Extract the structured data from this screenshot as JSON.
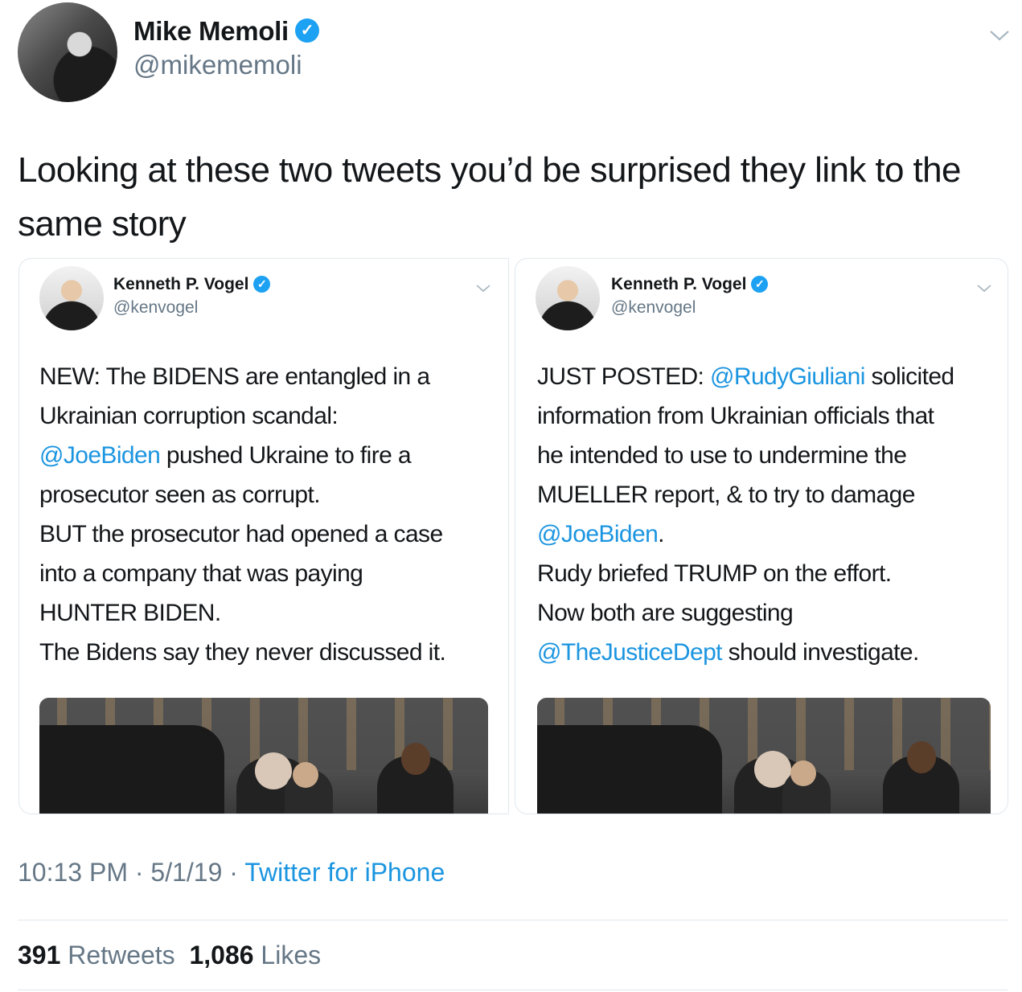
{
  "author": {
    "name": "Mike Memoli",
    "handle": "@mikememoli",
    "verified_icon": "✓"
  },
  "tweet_text": "Looking at these two tweets you’d be surprised they link to the same story",
  "quoted": [
    {
      "name": "Kenneth P. Vogel",
      "handle": "@kenvogel",
      "verified_icon": "✓",
      "lines": [
        [
          {
            "t": "NEW: The BIDENS are entangled in a",
            "m": false
          }
        ],
        [
          {
            "t": "Ukrainian corruption scandal:",
            "m": false
          }
        ],
        [
          {
            "t": "@JoeBiden",
            "m": true
          },
          {
            "t": " pushed Ukraine to fire a",
            "m": false
          }
        ],
        [
          {
            "t": "prosecutor seen as corrupt.",
            "m": false
          }
        ],
        [
          {
            "t": "BUT the prosecutor had opened a case",
            "m": false
          }
        ],
        [
          {
            "t": "into a company that was paying",
            "m": false
          }
        ],
        [
          {
            "t": "HUNTER BIDEN.",
            "m": false
          }
        ],
        [
          {
            "t": "The Bidens say they never discussed it.",
            "m": false
          }
        ]
      ]
    },
    {
      "name": "Kenneth P. Vogel",
      "handle": "@kenvogel",
      "verified_icon": "✓",
      "lines": [
        [
          {
            "t": "JUST POSTED: ",
            "m": false
          },
          {
            "t": "@RudyGiuliani",
            "m": true
          },
          {
            "t": " solicited",
            "m": false
          }
        ],
        [
          {
            "t": "information from Ukrainian officials that",
            "m": false
          }
        ],
        [
          {
            "t": "he intended to use to undermine the",
            "m": false
          }
        ],
        [
          {
            "t": "MUELLER report, & to try to damage",
            "m": false
          }
        ],
        [
          {
            "t": "@JoeBiden",
            "m": true
          },
          {
            "t": ".",
            "m": false
          }
        ],
        [
          {
            "t": "Rudy briefed TRUMP on the effort.",
            "m": false
          }
        ],
        [
          {
            "t": "Now both are suggesting",
            "m": false
          }
        ],
        [
          {
            "t": "@TheJusticeDept",
            "m": true
          },
          {
            "t": " should investigate.",
            "m": false
          }
        ]
      ]
    }
  ],
  "footer": {
    "time": "10:13 PM",
    "sep1": " · ",
    "date": "5/1/19",
    "sep2": " · ",
    "source": "Twitter for iPhone",
    "retweets_count": "391",
    "retweets_label": "Retweets",
    "likes_count": "1,086",
    "likes_label": "Likes"
  },
  "colors": {
    "link": "#1b95e0",
    "verified": "#1da1f2",
    "secondary_text": "#657786",
    "border": "#e1e8ed"
  },
  "icons": [
    "verified-badge-icon",
    "chevron-down-icon"
  ]
}
